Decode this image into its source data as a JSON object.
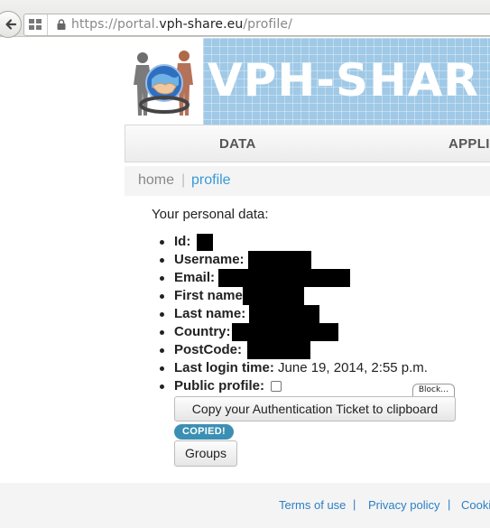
{
  "browser": {
    "url_prefix": "https://portal.",
    "url_domain": "vph-share.eu",
    "url_path": "/profile/"
  },
  "banner": {
    "title": "VPH-SHAR",
    "logo_icon": "vph-share-logo-icon"
  },
  "nav": {
    "items": [
      {
        "label": "DATA"
      },
      {
        "label": "APPLI"
      }
    ]
  },
  "breadcrumb": {
    "home": "home",
    "separator": "|",
    "current": "profile"
  },
  "profile": {
    "intro": "Your personal data:",
    "fields": {
      "id": "Id:",
      "username": "Username:",
      "email": "Email:",
      "first_name": "First name",
      "last_name": "Last name:",
      "country": "Country:",
      "postcode": "PostCode:",
      "last_login": "Last login time:",
      "public_profile": "Public profile:"
    },
    "last_login_value": "June 19, 2014, 2:55 p.m.",
    "public_profile_checked": false,
    "copy_ticket_button": "Copy your Authentication Ticket to clipboard",
    "copied_badge": "COPIED!",
    "block_tag": "Block…",
    "groups_button": "Groups"
  },
  "footer": {
    "terms": "Terms of use",
    "separator": "|",
    "privacy": "Privacy policy",
    "cookie": "Cooki"
  },
  "colors": {
    "link": "#3a9ad9",
    "footer_link": "#2b7fc4",
    "banner": "#9fc9e6",
    "badge": "#3b8fb3"
  }
}
